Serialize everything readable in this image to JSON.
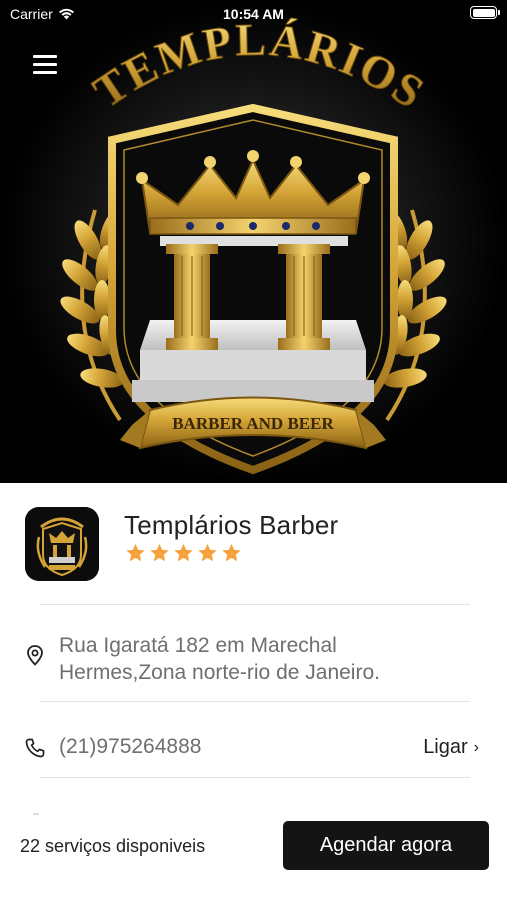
{
  "status_bar": {
    "carrier": "Carrier",
    "time": "10:54 AM"
  },
  "hero": {
    "logo_title": "TEMPLÁRIOS",
    "logo_ribbon": "BARBER AND BEER",
    "menu_icon": "hamburger-menu-icon"
  },
  "shop": {
    "name": "Templários Barber",
    "rating": 5,
    "rating_max": 5,
    "star_color": "#f5a13c",
    "address": "Rua Igaratá 182 em Marechal Hermes,Zona norte-rio de Janeiro.",
    "phone": "(21)975264888",
    "call_label": "Ligar"
  },
  "footer": {
    "services_text": "22 serviços disponiveis",
    "book_button": "Agendar agora"
  },
  "colors": {
    "accent_gold": "#d4a437",
    "button_bg": "#141414",
    "muted_text": "#6f6f6f"
  }
}
